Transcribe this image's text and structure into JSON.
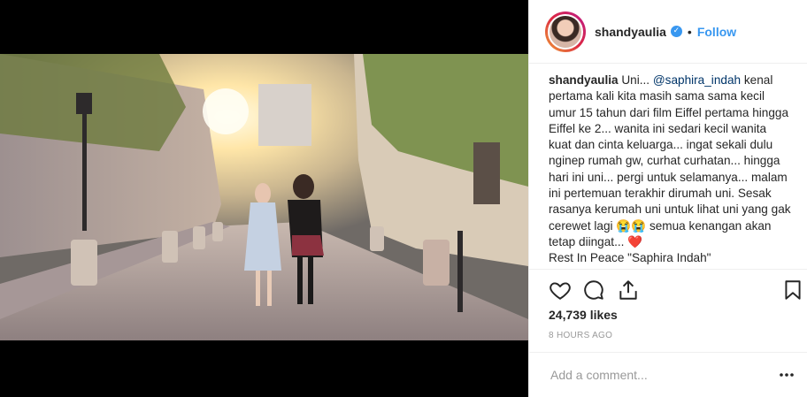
{
  "post": {
    "username": "shandyaulia",
    "verified": true,
    "separator": "•",
    "follow_label": "Follow",
    "caption_user": "shandyaulia",
    "caption_pre": " Uni... ",
    "caption_mention": "@saphira_indah",
    "caption_rest": " kenal pertama kali kita masih sama sama kecil umur 15 tahun dari film Eiffel pertama hingga Eiffel ke 2... wanita ini sedari kecil wanita kuat dan cinta keluarga... ingat sekali dulu nginep rumah gw, curhat curhatan... hingga hari ini uni... pergi untuk selamanya... malam ini pertemuan terakhir dirumah uni. Sesak rasanya kerumah uni untuk lihat uni yang gak cerewet lagi 😭😭 semua kenangan akan tetap diingat... ❤️\nRest In Peace \"Saphira Indah\"",
    "likes": "24,739 likes",
    "timestamp": "8 HOURS AGO",
    "comment_placeholder": "Add a comment..."
  },
  "icons": {
    "like": "heart-icon",
    "comment": "comment-icon",
    "share": "share-icon",
    "save": "bookmark-icon",
    "more": "more-options-icon",
    "verified": "verified-badge-icon"
  },
  "colors": {
    "accent": "#3897f0",
    "text": "#262626",
    "muted": "#999999",
    "border": "#efefef"
  }
}
